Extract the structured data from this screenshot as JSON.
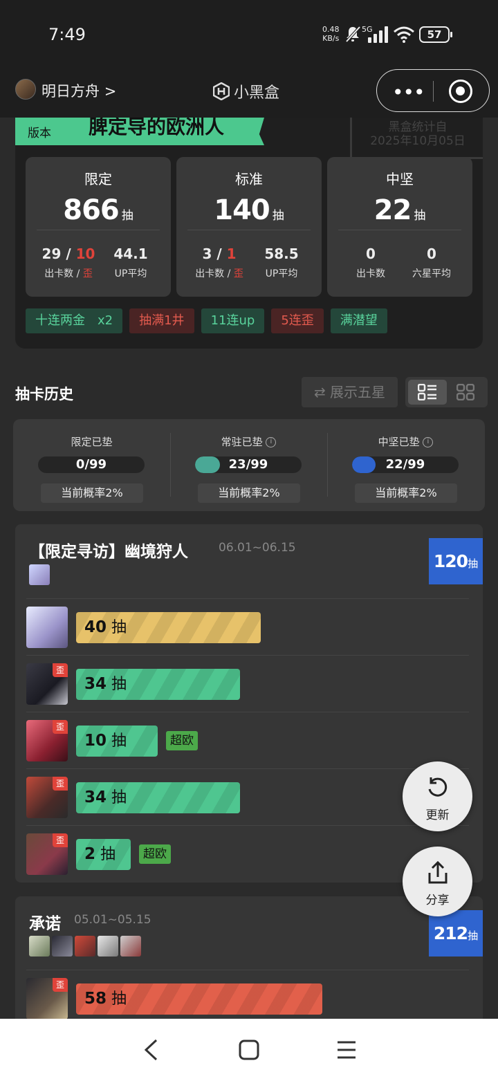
{
  "status_bar": {
    "time": "7:49",
    "speed_value": "0.48",
    "speed_unit": "KB/s",
    "network": "5G",
    "battery": "57"
  },
  "app_header": {
    "game_name": "明日方舟",
    "chevron": ">",
    "brand_name": "小黑盒",
    "more_icon": "more-dots-icon",
    "close_icon": "target-circle-icon"
  },
  "summary": {
    "banner_version": "版本",
    "banner_title": "脾定导的欧洲人",
    "stamp_line1": "黑盒统计自",
    "stamp_line2": "2025年10月05日",
    "stats": [
      {
        "label": "限定",
        "count": "866",
        "unit": "抽",
        "got": "29",
        "sep": "/",
        "off": "10",
        "avg": "44.1",
        "got_label": "出卡数",
        "label_sep": " / ",
        "off_label": "歪",
        "avg_label": "UP平均"
      },
      {
        "label": "标准",
        "count": "140",
        "unit": "抽",
        "got": "3",
        "sep": "/",
        "off": "1",
        "avg": "58.5",
        "got_label": "出卡数",
        "label_sep": " / ",
        "off_label": "歪",
        "avg_label": "UP平均"
      },
      {
        "label": "中坚",
        "count": "22",
        "unit": "抽",
        "got": "0",
        "avg": "0",
        "got_label": "出卡数",
        "avg_label": "六星平均"
      }
    ],
    "tags": [
      {
        "text": "十连两金　x2",
        "color": "green"
      },
      {
        "text": "抽满1井",
        "color": "red"
      },
      {
        "text": "11连up",
        "color": "green"
      },
      {
        "text": "5连歪",
        "color": "red"
      },
      {
        "text": "满潜望",
        "color": "green"
      }
    ]
  },
  "history": {
    "title": "抽卡历史",
    "toggle_five_star": "⇄ 展示五星",
    "view_list_icon": "list-view-icon",
    "view_grid_icon": "grid-view-icon"
  },
  "pity": [
    {
      "label": "限定已垫",
      "value": "0/99",
      "progress": 0,
      "rate": "当前概率2%",
      "info": false,
      "fill": "#5ac8a0"
    },
    {
      "label": "常驻已垫",
      "value": "23/99",
      "progress": 0.2323,
      "rate": "当前概率2%",
      "info": true,
      "fill": "#4aa896"
    },
    {
      "label": "中坚已垫",
      "value": "22/99",
      "progress": 0.2222,
      "rate": "当前概率2%",
      "info": true,
      "fill": "#2f64cf"
    }
  ],
  "pools": [
    {
      "title": "【限定寻访】幽境狩人",
      "dates": "06.01~06.15",
      "total": "120",
      "unit": "抽",
      "rows": [
        {
          "pulls": "40",
          "unit": "抽",
          "off": false,
          "bar_color": "#e7c26a",
          "tag": "",
          "max_scale": 0.42
        },
        {
          "pulls": "34",
          "unit": "抽",
          "off": true,
          "off_label": "歪",
          "bar_color": "#4fc690",
          "tag": ""
        },
        {
          "pulls": "10",
          "unit": "抽",
          "off": true,
          "off_label": "歪",
          "bar_color": "#4fc690",
          "tag": "超欧"
        },
        {
          "pulls": "34",
          "unit": "抽",
          "off": true,
          "off_label": "歪",
          "bar_color": "#4fc690",
          "tag": ""
        },
        {
          "pulls": "2",
          "unit": "抽",
          "off": true,
          "off_label": "歪",
          "bar_color": "#4fc690",
          "tag": "超欧"
        }
      ]
    },
    {
      "title": "承诺",
      "dates": "05.01~05.15",
      "total": "212",
      "unit": "抽",
      "rows": [
        {
          "pulls": "58",
          "unit": "抽",
          "off": true,
          "off_label": "歪",
          "bar_color": "#e2604b",
          "tag": ""
        }
      ]
    }
  ],
  "fabs": {
    "refresh_label": "更新",
    "share_label": "分享"
  }
}
